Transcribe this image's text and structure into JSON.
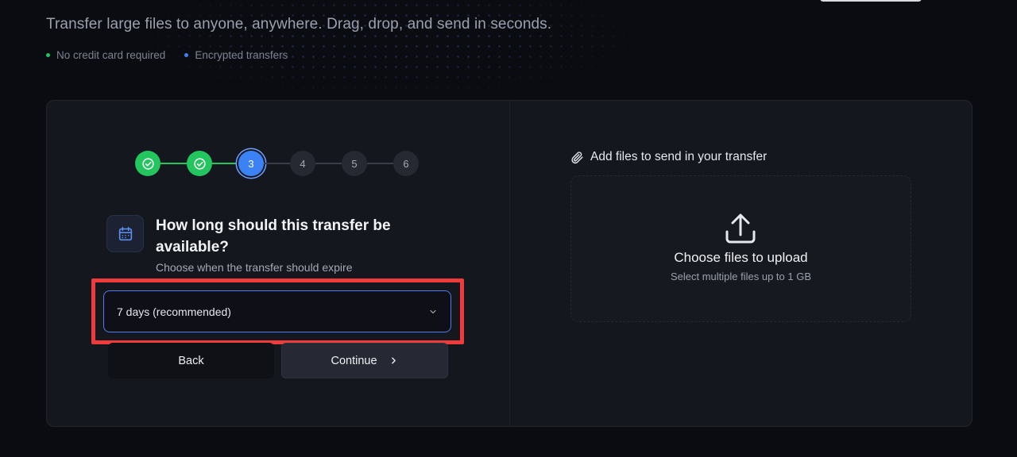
{
  "header": {
    "tagline": "Transfer large files to anyone, anywhere. Drag, drop, and send in seconds.",
    "features": [
      {
        "label": "No credit card required",
        "dot_color": "#22c55e"
      },
      {
        "label": "Encrypted transfers",
        "dot_color": "#3b82f6"
      }
    ]
  },
  "stepper": {
    "steps": [
      {
        "label": "",
        "status": "completed",
        "icon": "check-circle-icon"
      },
      {
        "label": "",
        "status": "completed",
        "icon": "check-circle-icon"
      },
      {
        "label": "3",
        "status": "current"
      },
      {
        "label": "4",
        "status": "upcoming"
      },
      {
        "label": "5",
        "status": "upcoming"
      },
      {
        "label": "6",
        "status": "upcoming"
      }
    ]
  },
  "question": {
    "icon": "calendar-icon",
    "title": "How long should this transfer be available?",
    "subtitle": "Choose when the transfer should expire"
  },
  "expiry_select": {
    "value": "7 days (recommended)",
    "icon": "chevron-down-icon",
    "highlight_color": "#ef3b3b"
  },
  "actions": {
    "back_label": "Back",
    "continue_label": "Continue",
    "continue_icon": "chevron-right-icon"
  },
  "files": {
    "label": "Add files to send in your transfer",
    "label_icon": "paperclip-icon",
    "dropzone_title": "Choose files to upload",
    "dropzone_subtitle": "Select multiple files up to 1 GB",
    "dropzone_icon": "upload-icon"
  },
  "colors": {
    "accent": "#3b82f6",
    "success": "#22c55e",
    "background": "#0b0c11",
    "card": "#15171e"
  }
}
